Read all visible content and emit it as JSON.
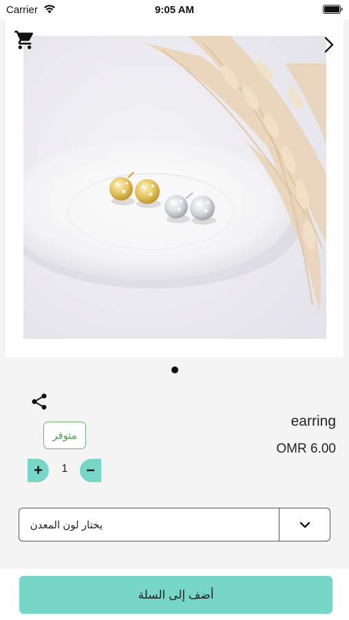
{
  "status_bar": {
    "carrier": "Carrier",
    "time": "9:05 AM"
  },
  "product": {
    "name": "earring",
    "price": "OMR 6.00",
    "availability": "متوفر",
    "image_icons": [
      "cart-icon",
      "next-arrow-icon"
    ],
    "image_count": 1,
    "active_image": 1
  },
  "quantity": {
    "value": "1",
    "increase_label": "+",
    "decrease_label": "−"
  },
  "options": {
    "metal_color_placeholder": "يختار لون المعدن"
  },
  "actions": {
    "add_to_cart_label": "أضف إلى السلة"
  },
  "colors": {
    "accent": "#78d6c6",
    "stock_badge": "#6ab46a",
    "background": "#f4f4f4"
  }
}
